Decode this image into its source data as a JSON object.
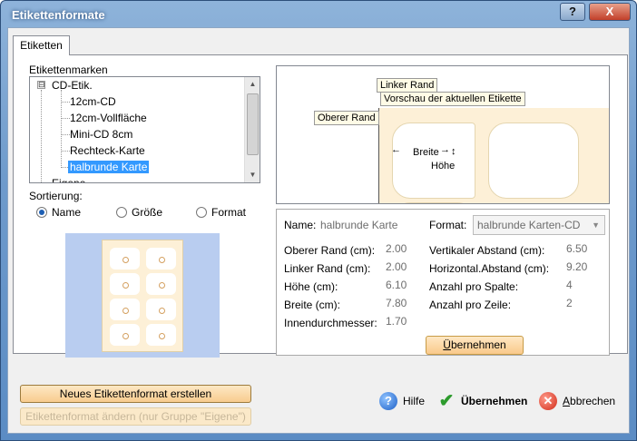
{
  "window": {
    "title": "Etikettenformate",
    "help_glyph": "?",
    "close_glyph": "X"
  },
  "tabs": [
    {
      "label": "Etiketten"
    }
  ],
  "brands": {
    "label": "Etikettenmarken",
    "root": {
      "toggle": "⊟",
      "label": "CD-Etik."
    },
    "items": [
      "12cm-CD",
      "12cm-Vollfläche",
      "Mini-CD 8cm",
      "Rechteck-Karte",
      "halbrunde Karte"
    ],
    "selected": "halbrunde Karte",
    "partial_next": "Eigene"
  },
  "sorting": {
    "label": "Sortierung:",
    "options": [
      {
        "label": "Name",
        "selected": true
      },
      {
        "label": "Größe",
        "selected": false
      },
      {
        "label": "Format",
        "selected": false
      }
    ]
  },
  "preview": {
    "callout_left_margin": "Linker Rand",
    "callout_title": "Vorschau der aktuellen Etikette",
    "callout_top_margin": "Oberer Rand",
    "width_label": "Breite",
    "height_label": "Höhe"
  },
  "details": {
    "name_label": "Name:",
    "name_value": "halbrunde Karte",
    "format_label": "Format:",
    "format_value": "halbrunde Karten-CD",
    "left_fields": [
      {
        "label": "Oberer Rand (cm):",
        "value": "2.00"
      },
      {
        "label": "Linker Rand (cm):",
        "value": "2.00"
      },
      {
        "label": "Höhe (cm):",
        "value": "6.10"
      },
      {
        "label": "Breite (cm):",
        "value": "7.80"
      },
      {
        "label": "Innendurchmesser:",
        "value": "1.70"
      }
    ],
    "right_fields": [
      {
        "label": "Vertikaler Abstand (cm):",
        "value": "6.50"
      },
      {
        "label": "Horizontal.Abstand (cm):",
        "value": "9.20"
      },
      {
        "label": "Anzahl pro Spalte:",
        "value": "4"
      },
      {
        "label": "Anzahl pro Zeile:",
        "value": "2"
      }
    ],
    "apply_button": {
      "u": "Ü",
      "rest": "bernehmen"
    }
  },
  "buttons": {
    "new_format": "Neues Etikettenformat erstellen",
    "edit_format": "Etikettenformat ändern (nur Gruppe \"Eigene\")"
  },
  "footer": {
    "help": "Hilfe",
    "apply": "Übernehmen",
    "cancel": {
      "u": "A",
      "rest": "bbrechen"
    }
  },
  "colors": {
    "accent": "#3399ff",
    "sheet": "#fdf0d7",
    "preview_bg": "#b9cdf0"
  }
}
